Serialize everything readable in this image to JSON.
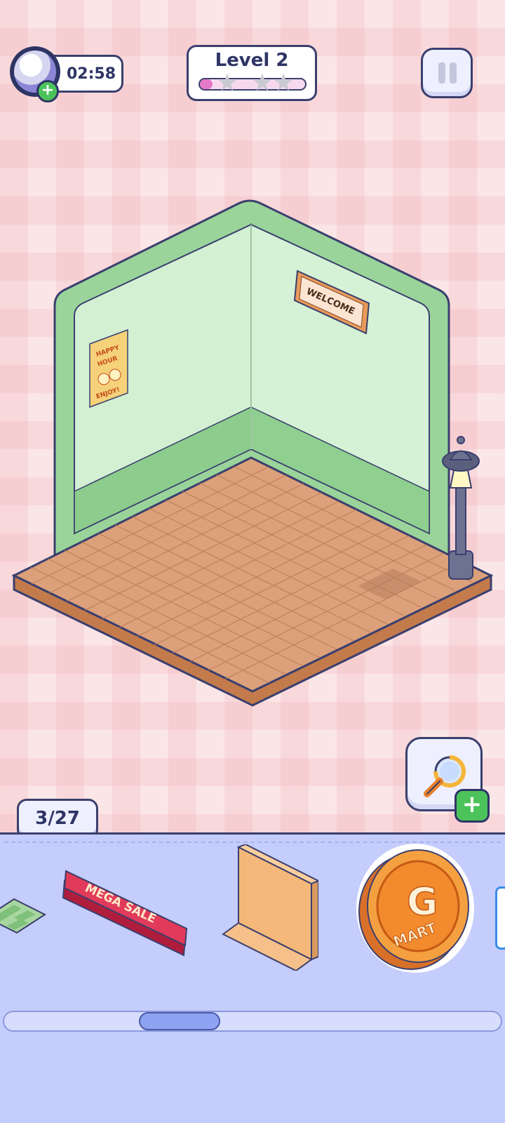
{
  "hud": {
    "timer": "02:58",
    "timer_add_symbol": "+",
    "level_label": "Level 2",
    "level_progress_fraction": 0.12,
    "stars_total": 3,
    "stars_earned": 0
  },
  "room": {
    "wall_sign_text": "WELCOME",
    "poster_lines": [
      "HAPPY",
      "HOUR",
      "ENJOY!"
    ]
  },
  "hint": {
    "add_symbol": "+"
  },
  "counter": {
    "text": "3/27"
  },
  "tray": {
    "items": [
      {
        "name": "green-checkered-rug"
      },
      {
        "name": "mega-sale-sign",
        "label": "MEGA SALE"
      },
      {
        "name": "wooden-shelf"
      },
      {
        "name": "gmart-coin-sign",
        "label_top": "G",
        "label_bottom": "MART"
      }
    ]
  },
  "colors": {
    "outline": "#3a3f6e",
    "wall_green": "#d3f0d3",
    "floor_tile": "#d89a74",
    "tray_bg": "#c5cdfc",
    "accent_green": "#4cc35a"
  }
}
